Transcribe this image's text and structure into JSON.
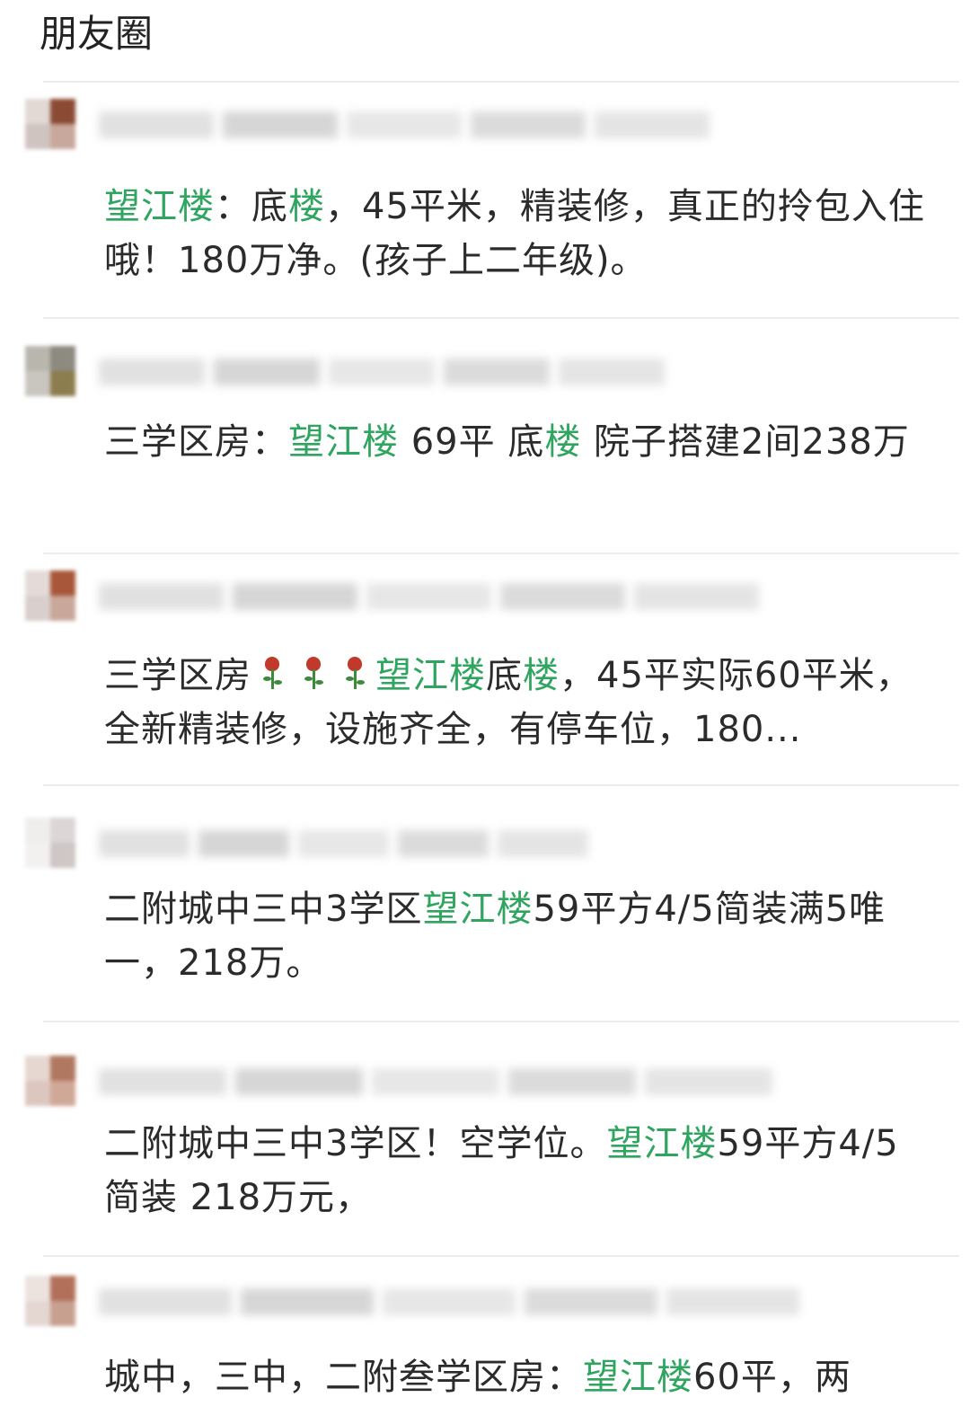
{
  "header": {
    "title": "朋友圈"
  },
  "colors": {
    "highlight": "#2fa55f",
    "text": "#2b2b2b"
  },
  "posts": [
    {
      "parts": [
        {
          "t": "望江楼",
          "hl": true
        },
        {
          "t": "：底",
          "hl": false
        },
        {
          "t": "楼",
          "hl": true
        },
        {
          "t": "，45平米，精装修，真正的拎包入住哦！180万净。(孩子上二年级)。",
          "hl": false
        }
      ]
    },
    {
      "parts": [
        {
          "t": "三学区房：",
          "hl": false
        },
        {
          "t": "望江楼",
          "hl": true
        },
        {
          "t": " 69平 底",
          "hl": false
        },
        {
          "t": "楼",
          "hl": true
        },
        {
          "t": " 院子搭建2间238万",
          "hl": false
        }
      ]
    },
    {
      "parts": [
        {
          "t": "三学区房",
          "hl": false
        },
        {
          "icon": "rose-icon"
        },
        {
          "icon": "rose-icon"
        },
        {
          "icon": "rose-icon"
        },
        {
          "t": "望江楼",
          "hl": true
        },
        {
          "t": "底",
          "hl": false
        },
        {
          "t": "楼",
          "hl": true
        },
        {
          "t": "，45平实际60平米，全新精装修，设施齐全，有停车位，180...",
          "hl": false
        }
      ]
    },
    {
      "parts": [
        {
          "t": "二附城中三中3学区",
          "hl": false
        },
        {
          "t": "望江楼",
          "hl": true
        },
        {
          "t": "59平方4/5简装满5唯一，218万。",
          "hl": false
        }
      ]
    },
    {
      "parts": [
        {
          "t": "二附城中三中3学区！空学位。",
          "hl": false
        },
        {
          "t": "望江楼",
          "hl": true
        },
        {
          "t": "59平方4/5简装 218万元，",
          "hl": false
        }
      ]
    },
    {
      "parts": [
        {
          "t": "城中，三中，二附叁学区房：",
          "hl": false
        },
        {
          "t": "望江楼",
          "hl": true
        },
        {
          "t": "60平，两",
          "hl": false
        }
      ]
    }
  ]
}
